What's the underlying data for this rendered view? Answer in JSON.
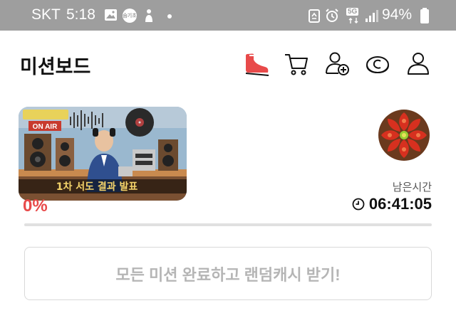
{
  "status_bar": {
    "carrier": "SKT",
    "time": "5:18",
    "notification_badge": "숨기초",
    "network": "5G",
    "battery": "94%",
    "icons": [
      "gallery-icon",
      "app-badge-icon",
      "person-icon",
      "dot-icon",
      "recycle-icon",
      "alarm-icon",
      "signal-icon",
      "battery-icon"
    ]
  },
  "header": {
    "title": "미션보드",
    "icons": [
      "shoe-icon",
      "cart-icon",
      "add-friend-icon",
      "coin-icon",
      "profile-icon"
    ]
  },
  "mission": {
    "thumbnail_caption": "1차 서도 결과 발표",
    "thumbnail_sign": "ON AIR",
    "progress_text": "0%",
    "progress_value": 0,
    "remaining_label": "남은시간",
    "remaining_time": "06:41:05"
  },
  "reward": {
    "button_label": "모든 미션 완료하고 랜덤캐시 받기!"
  },
  "colors": {
    "accent": "#e84a4a",
    "status_bar": "#9e9e9e",
    "disabled_text": "#b5b5b5"
  }
}
